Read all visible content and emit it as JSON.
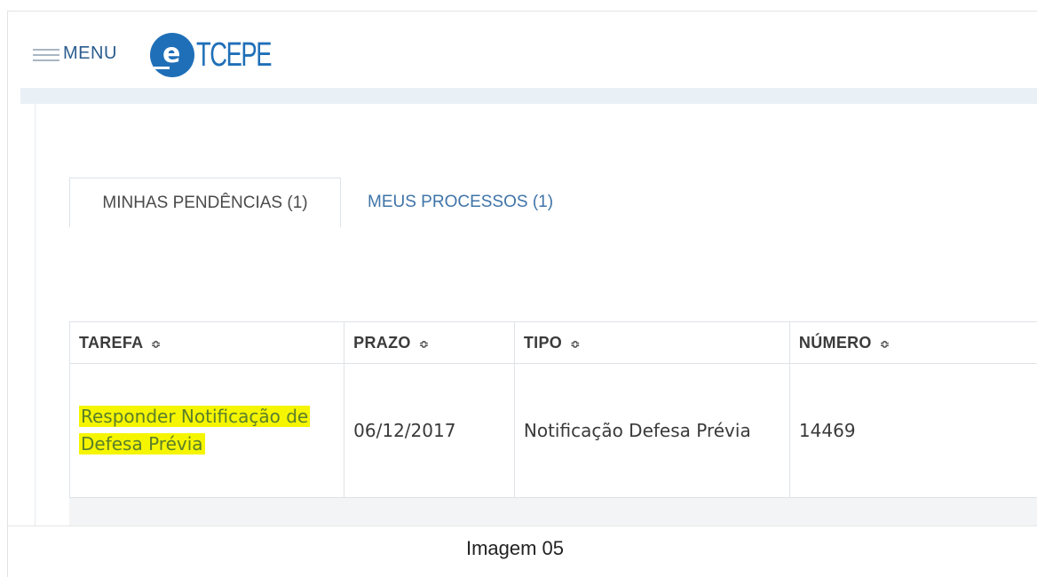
{
  "header": {
    "menu_label": "MENU",
    "logo": {
      "circle_letter": "e",
      "text": "TCEPE"
    }
  },
  "tabs": [
    {
      "label": "MINHAS PENDÊNCIAS (1)",
      "active": true
    },
    {
      "label": "MEUS PROCESSOS (1)",
      "active": false
    }
  ],
  "table": {
    "columns": [
      "TAREFA",
      "PRAZO",
      "TIPO",
      "NÚMERO"
    ],
    "sort_icon": "sort-updown-icon",
    "rows": [
      {
        "tarefa": "Responder Notificação de Defesa Prévia",
        "prazo": "06/12/2017",
        "tipo": "Notificação Defesa Prévia",
        "numero": "14469"
      }
    ]
  },
  "caption": "Imagem 05",
  "colors": {
    "brand_blue": "#1f6fb8",
    "link_blue": "#3f74a8",
    "highlight_yellow": "#f5f500",
    "highlight_text": "#5b7f2b"
  }
}
